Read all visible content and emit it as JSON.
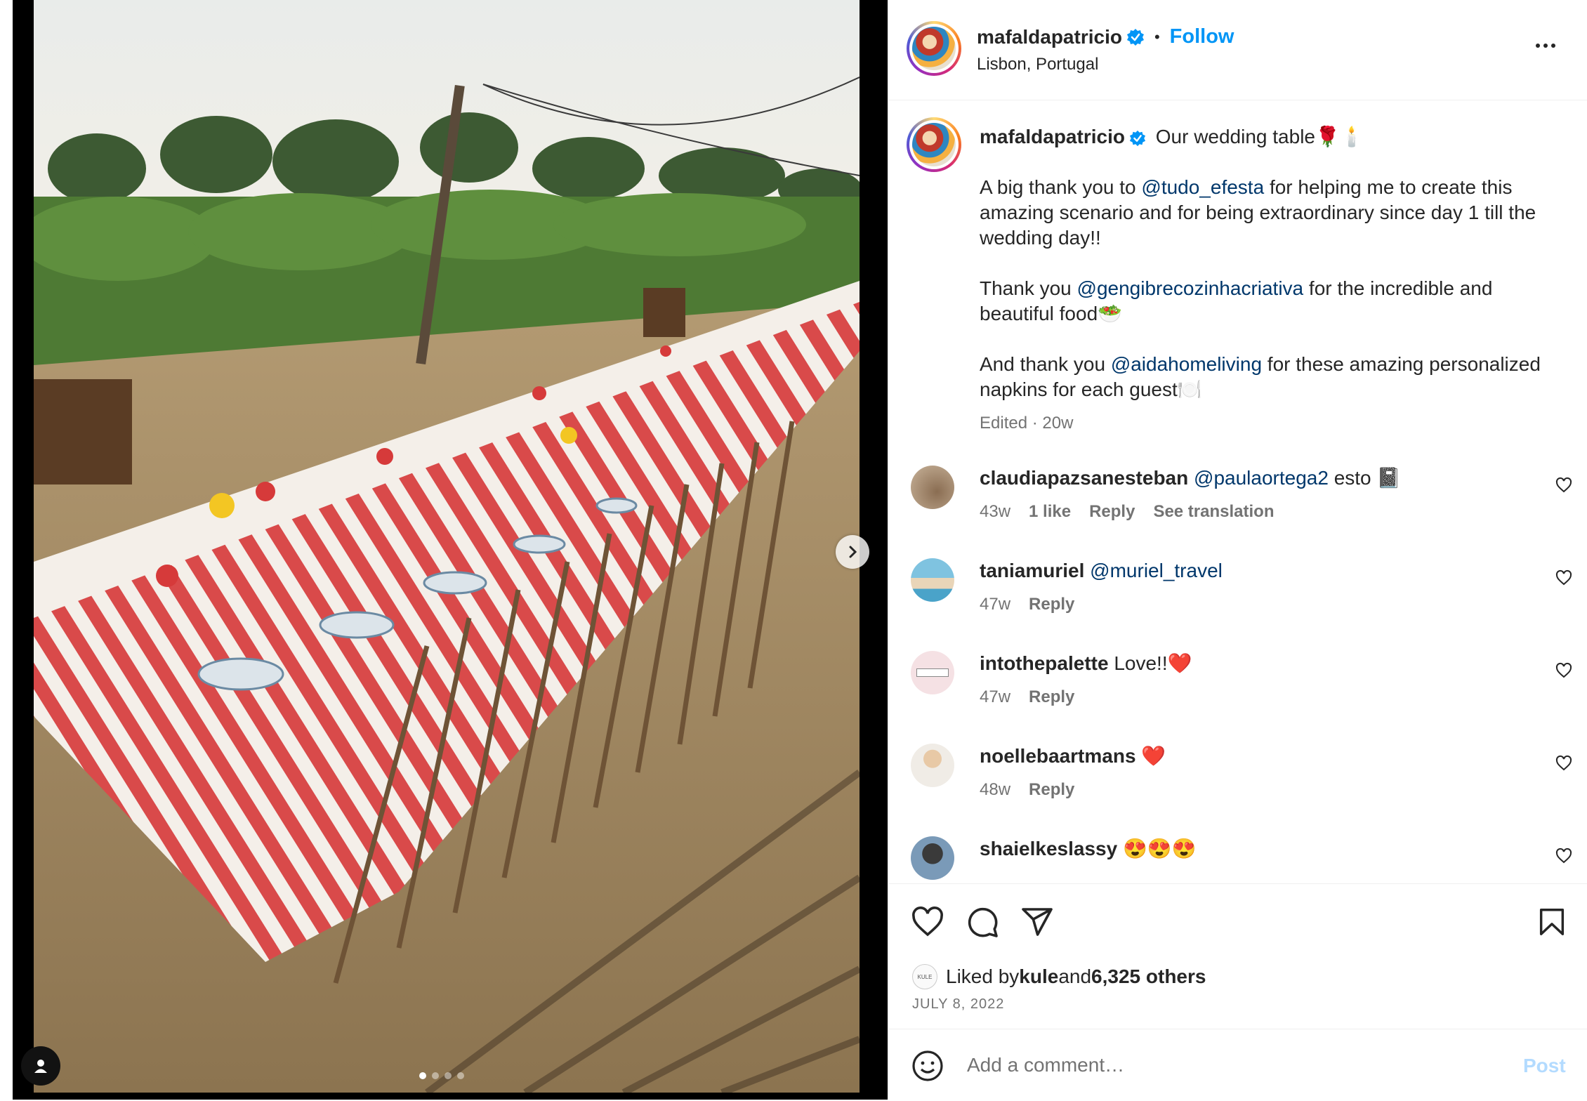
{
  "photo": {
    "alt_scene": "",
    "carousel": {
      "count": 4,
      "active_index": 0
    }
  },
  "header": {
    "username": "mafaldapatricio",
    "separator": "•",
    "follow_label": "Follow",
    "location": "Lisbon, Portugal"
  },
  "caption": {
    "username": "mafaldapatricio",
    "title": "Our wedding table🌹🕯️",
    "p1_a": "A big thank you to ",
    "p1_mention": "@tudo_efesta",
    "p1_b": " for helping me to create this amazing scenario and for being extraordinary since day 1 till the wedding day!!",
    "p2_a": "Thank you ",
    "p2_mention": "@gengibrecozinhacriativa",
    "p2_b": " for the incredible and beautiful food🥗",
    "p3_a": "And thank you ",
    "p3_mention": "@aidahomeliving",
    "p3_b": " for these amazing personalized napkins for each guest🍽️",
    "meta": "Edited · 20w"
  },
  "comments": [
    {
      "username": "claudiapazsanesteban",
      "mention": "@paulaortega2",
      "text": " esto 📓",
      "time": "43w",
      "likes": "1 like",
      "reply": "Reply",
      "translate": "See translation"
    },
    {
      "username": "taniamuriel",
      "mention": "@muriel_travel",
      "text": "",
      "time": "47w",
      "reply": "Reply"
    },
    {
      "username": "intothepalette",
      "mention": "",
      "text": "Love!!❤️",
      "time": "47w",
      "reply": "Reply"
    },
    {
      "username": "noellebaartmans",
      "mention": "",
      "text": "❤️",
      "time": "48w",
      "reply": "Reply"
    },
    {
      "username": "shaielkeslassy",
      "mention": "",
      "text": "😍😍😍",
      "time": "",
      "reply": ""
    }
  ],
  "likes": {
    "prefix": "Liked by ",
    "user": "kule",
    "middle": " and ",
    "others": "6,325 others",
    "avatar_text": "KULE"
  },
  "date": "JULY 8, 2022",
  "comment_box": {
    "placeholder": "Add a comment…",
    "post_label": "Post"
  },
  "colors": {
    "accent": "#0095f6",
    "mention": "#00376b",
    "muted": "#737373",
    "post_disabled": "#b3dbff",
    "stripe_red": "#d94a4a"
  },
  "icons": [
    "verified-badge-icon",
    "more-options-icon",
    "heart-icon",
    "comment-icon",
    "share-icon",
    "bookmark-icon",
    "emoji-icon",
    "next-arrow-icon",
    "user-tag-icon"
  ]
}
